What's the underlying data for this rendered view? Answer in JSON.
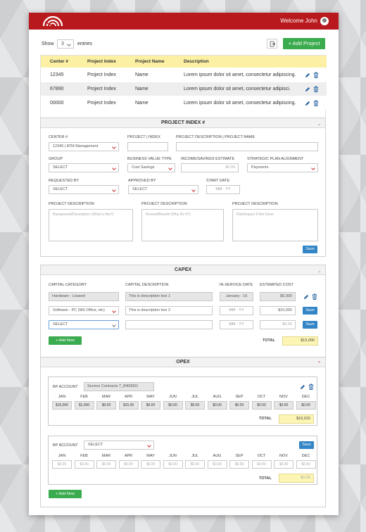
{
  "header": {
    "welcome": "Welcome John"
  },
  "entries": {
    "show": "Show",
    "count": "3",
    "label": "entries"
  },
  "add_project": "+ Add Project",
  "table": {
    "columns": [
      "Center #",
      "Project Index",
      "Project Name",
      "Description"
    ],
    "rows": [
      [
        "12345",
        "Project Index",
        "Name",
        "Lorem ipsum dolor sit amet, consectetur adipiscing."
      ],
      [
        "67890",
        "Project Index",
        "Name",
        "Lorem ipsum dolor sit amet, consectetur adipisci."
      ],
      [
        "00000",
        "Project Index",
        "Name",
        "Lorem ipsum dolor sit amet, consectetur adipiscing."
      ]
    ]
  },
  "project_index": {
    "title": "PROJECT INDEX #",
    "center_label": "CENTER #",
    "center_value": "12345  |  ATM Management",
    "project_index_label": "PROJECT | INDEX",
    "project_desc_label": "PROJECT DESCRIPTION  |  PROJECT NAME",
    "group_label": "GROUP",
    "group_value": "SELECT",
    "bvt_label": "BUSINESS VALUE TYPE",
    "bvt_value": "Cost Savings",
    "income_label": "INCOME/SAVINGS ESTIMATE",
    "income_value": "$0.00",
    "strategic_label": "STRATEGIC PLAN ALIGNMENT",
    "strategic_value": "Payments",
    "requested_label": "REQUESTED BY",
    "requested_value": "SELECT",
    "approved_label": "APPROVED BY",
    "approved_value": "SELECT",
    "start_label": "START DATE",
    "start_value": "MM - YY",
    "desc1_label": "PROJECT DESCRIPTION",
    "desc1_placeholder": "Background/Description (What is this?)",
    "desc2_label": "PROJECT DESCRIPTION",
    "desc2_placeholder": "Reward/Benefit (Why Do It?)",
    "desc3_label": "PROJECT DESCRIPTION",
    "desc3_placeholder": "Risk/Impact If Not Done",
    "save": "Save"
  },
  "capex": {
    "title": "CAPEX",
    "col_category": "CAPITAL CATEGORY",
    "col_description": "CAPITAL DESCRIPTION",
    "col_date": "IN-SERVICE DATE",
    "col_cost": "ESTIMATED COST",
    "rows": [
      {
        "category": "Hardware - Leased",
        "description": "This is description box 1",
        "date": "January - 16",
        "cost": "$5,000"
      },
      {
        "category": "Software - PC (MS Office, etc)",
        "description": "This is description box 2",
        "date": "MM - YY",
        "cost": "$10,000"
      },
      {
        "category": "SELECT",
        "description": "",
        "date": "MM - YY",
        "cost": "$0.00"
      }
    ],
    "save": "Save",
    "add_new": "+ Add New",
    "total_label": "TOTAL",
    "total_value": "$15,000"
  },
  "opex": {
    "title": "OPEX",
    "bp_label": "BP ACCOUNT",
    "months": [
      "JAN",
      "FEB",
      "MAR",
      "APR",
      "MAY",
      "JUN",
      "JUL",
      "AUG",
      "SEP",
      "OCT",
      "NOV",
      "DEC"
    ],
    "account1": {
      "value": "Service Contracts 7_8400001",
      "values": [
        "$15,000",
        "$1,000",
        "$0.00",
        "$15.00",
        "$0.00",
        "$0.00",
        "$0.00",
        "$0.00",
        "$0.00",
        "$0.00",
        "$0.00",
        "$0.00"
      ],
      "total_label": "TOTAL",
      "total": "$16,015"
    },
    "account2": {
      "value": "SELECT",
      "values": [
        "$0.00",
        "$0.00",
        "$0.00",
        "$0.00",
        "$0.00",
        "$0.00",
        "$0.00",
        "$0.00",
        "$0.00",
        "$0.00",
        "$0.00",
        "$0.00"
      ],
      "total_label": "TOTAL",
      "total": "$0.00"
    },
    "save": "Save",
    "add_new": "+ Add New"
  },
  "colors": {
    "brand_red": "#b8191c",
    "green": "#3aab4e",
    "blue": "#3385c6",
    "yellow": "#fdf0a8"
  }
}
